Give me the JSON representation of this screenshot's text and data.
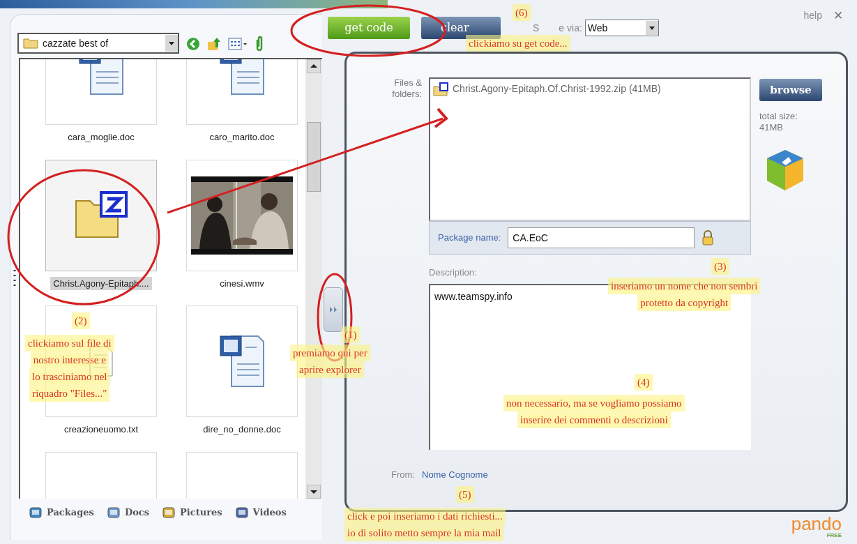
{
  "explorer": {
    "folder": "cazzate best of",
    "files": [
      {
        "kind": "doc",
        "name": "cara_moglie.doc",
        "selected": false
      },
      {
        "kind": "doc",
        "name": "caro_marito.doc",
        "selected": false
      },
      {
        "kind": "zip",
        "name": "Christ.Agony-Epitaph....",
        "selected": true
      },
      {
        "kind": "video",
        "name": "cinesi.wmv",
        "selected": false
      },
      {
        "kind": "txt",
        "name": "creazioneuomo.txt",
        "selected": false
      },
      {
        "kind": "doc",
        "name": "dire_no_donne.doc",
        "selected": false
      },
      {
        "kind": "blank",
        "selected": false
      },
      {
        "kind": "blank",
        "selected": false
      }
    ],
    "tabs": [
      {
        "kind": "packages",
        "label": "Packages"
      },
      {
        "kind": "docs",
        "label": "Docs"
      },
      {
        "kind": "pictures",
        "label": "Pictures"
      },
      {
        "kind": "videos",
        "label": "Videos"
      }
    ]
  },
  "toolbar": {
    "get_code": "get code",
    "clear": "clear",
    "share_label_start": "S",
    "share_label_end": "e via:",
    "share_value": "Web",
    "help": "help",
    "close": "✕"
  },
  "form": {
    "files_label": "Files & folders:",
    "attached": [
      {
        "name": "Christ.Agony-Epitaph.Of.Christ-1992.zip (41MB)"
      }
    ],
    "browse": "browse",
    "total_label": "total size:",
    "total_value": "41MB",
    "package_label": "Package name:",
    "package_value": "CA.EoC",
    "description_label": "Description:",
    "description_value": "www.teamspy.info",
    "from_label": "From:",
    "from_value": "Nome Cognome"
  },
  "logo": {
    "name": "pando",
    "tag": "FREE"
  },
  "notes": [
    {
      "number": "(6)",
      "lines": [
        "clickiamo su get code..."
      ]
    },
    {
      "number": "(3)",
      "lines": [
        "inseriamo un nome che non sembri",
        "protetto da copyright"
      ]
    },
    {
      "number": "(2)",
      "lines": [
        "clickiamo sul file di",
        "nostro interesse e",
        "lo trasciniamo nel",
        "riquadro \"Files...\""
      ]
    },
    {
      "number": "(1)",
      "lines": [
        "premiamo qui per",
        "aprire explorer"
      ]
    },
    {
      "number": "(4)",
      "lines": [
        "non necessario, ma se vogliamo possiamo",
        "inserire dei commenti o descrizioni"
      ]
    },
    {
      "number": "(5)",
      "lines": [
        "click e poi inseriamo i dati richiesti...",
        "io di solito metto sempre la mia mail"
      ]
    }
  ]
}
